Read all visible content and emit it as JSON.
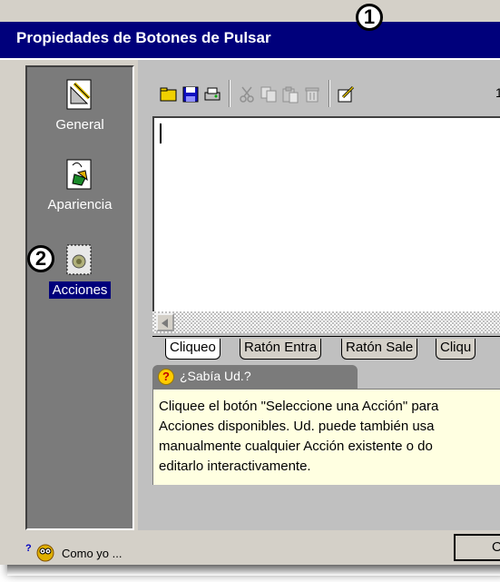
{
  "window": {
    "title": "Propiedades de Botones de Pulsar"
  },
  "callouts": {
    "one": "1",
    "two": "2"
  },
  "sidebar": {
    "items": [
      {
        "label": "General",
        "icon": "pencil-ruler-icon",
        "selected": false
      },
      {
        "label": "Apariencia",
        "icon": "paint-brush-icon",
        "selected": false
      },
      {
        "label": "Acciones",
        "icon": "gears-icon",
        "selected": true
      }
    ]
  },
  "toolbar": {
    "icons": [
      "open-folder-icon",
      "save-disk-icon",
      "print-icon",
      "cut-icon",
      "copy-icon",
      "paste-icon",
      "delete-icon",
      "edit-icon"
    ],
    "line_number": "1"
  },
  "tabs": [
    {
      "label": "Cliqueo",
      "active": true
    },
    {
      "label": "Ratón Entra",
      "active": false
    },
    {
      "label": "Ratón Sale",
      "active": false
    },
    {
      "label": "Cliqu",
      "active": false
    }
  ],
  "tip": {
    "title": "¿Sabía Ud.?",
    "lines": [
      "Cliquee el botón \"Seleccione una Acción\" para",
      "Acciones disponibles. Ud. puede también usa",
      "manualmente cualquier Acción existente o do",
      "editarlo interactivamente."
    ]
  },
  "footer": {
    "help_label": "Como yo ..."
  },
  "buttons": {
    "ok_partial": "O"
  },
  "colors": {
    "titlebar": "#00007b",
    "sidebar": "#7b7b7b",
    "tip_bg": "#ffffe1",
    "face": "#d4d0c8"
  }
}
